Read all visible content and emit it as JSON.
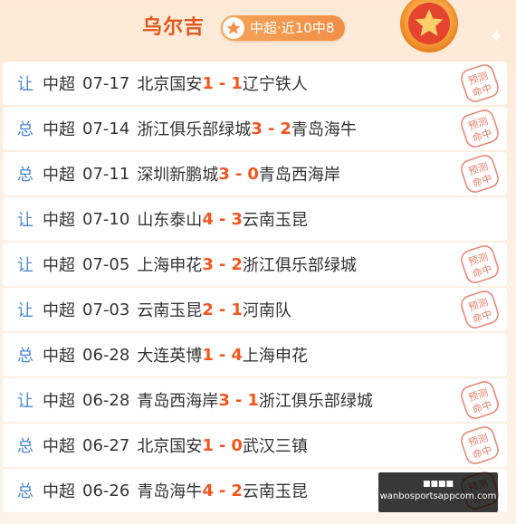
{
  "header": {
    "expert_name": "乌尔吉",
    "badge_text": "中超·近10中8"
  },
  "records": [
    {
      "type": "让",
      "league": "中超",
      "date": "07-17",
      "home": "北京国安",
      "home_score": "1",
      "away_score": "1",
      "away": "辽宁铁人",
      "hit": true
    },
    {
      "type": "总",
      "league": "中超",
      "date": "07-14",
      "home": "浙江俱乐部绿城",
      "home_score": "3",
      "away_score": "2",
      "away": "青岛海牛",
      "hit": true
    },
    {
      "type": "总",
      "league": "中超",
      "date": "07-11",
      "home": "深圳新鹏城",
      "home_score": "3",
      "away_score": "0",
      "away": "青岛西海岸",
      "hit": true
    },
    {
      "type": "让",
      "league": "中超",
      "date": "07-10",
      "home": "山东泰山",
      "home_score": "4",
      "away_score": "3",
      "away": "云南玉昆",
      "hit": false
    },
    {
      "type": "让",
      "league": "中超",
      "date": "07-05",
      "home": "上海申花",
      "home_score": "3",
      "away_score": "2",
      "away": "浙江俱乐部绿城",
      "hit": true
    },
    {
      "type": "让",
      "league": "中超",
      "date": "07-03",
      "home": "云南玉昆",
      "home_score": "2",
      "away_score": "1",
      "away": "河南队",
      "hit": true
    },
    {
      "type": "总",
      "league": "中超",
      "date": "06-28",
      "home": "大连英博",
      "home_score": "1",
      "away_score": "4",
      "away": "上海申花",
      "hit": false
    },
    {
      "type": "让",
      "league": "中超",
      "date": "06-28",
      "home": "青岛西海岸",
      "home_score": "3",
      "away_score": "1",
      "away": "浙江俱乐部绿城",
      "hit": true
    },
    {
      "type": "总",
      "league": "中超",
      "date": "06-27",
      "home": "北京国安",
      "home_score": "1",
      "away_score": "0",
      "away": "武汉三镇",
      "hit": true
    },
    {
      "type": "总",
      "league": "中超",
      "date": "06-26",
      "home": "青岛海牛",
      "home_score": "4",
      "away_score": "2",
      "away": "云南玉昆",
      "hit": true
    }
  ],
  "stamp_text": [
    "预测",
    "命中"
  ],
  "watermark": {
    "top": "■■■■",
    "bottom": "wanbosportsappcom.com"
  },
  "colors": {
    "accent": "#e2561d",
    "score": "#f2561d",
    "type_label": "#4a86d8",
    "stamp": "#e0604a"
  }
}
